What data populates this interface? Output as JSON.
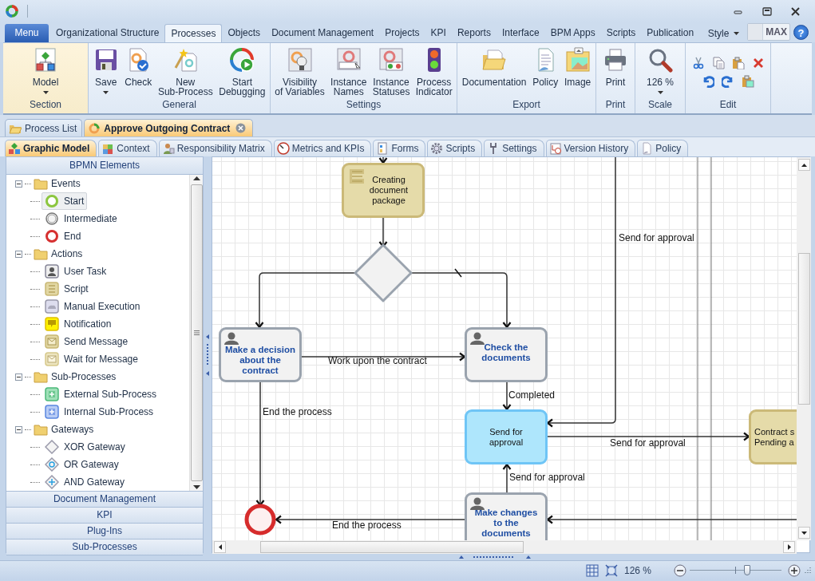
{
  "ribbon_tabs": [
    {
      "label": "Menu",
      "kind": "menu",
      "selected": false
    },
    {
      "label": "Organizational Structure",
      "kind": "tab",
      "selected": false
    },
    {
      "label": "Processes",
      "kind": "tab",
      "selected": true
    },
    {
      "label": "Objects",
      "kind": "tab",
      "selected": false
    },
    {
      "label": "Document Management",
      "kind": "tab",
      "selected": false
    },
    {
      "label": "Projects",
      "kind": "tab",
      "selected": false
    },
    {
      "label": "KPI",
      "kind": "tab",
      "selected": false
    },
    {
      "label": "Reports",
      "kind": "tab",
      "selected": false
    },
    {
      "label": "Interface",
      "kind": "tab",
      "selected": false
    },
    {
      "label": "BPM Apps",
      "kind": "tab",
      "selected": false
    },
    {
      "label": "Scripts",
      "kind": "tab",
      "selected": false
    },
    {
      "label": "Publication",
      "kind": "tab",
      "selected": false
    }
  ],
  "style_menu": {
    "label": "Style"
  },
  "max_toggle": {
    "label": "MAX",
    "on": false
  },
  "help_button": {
    "label": "?"
  },
  "ribbon": {
    "groups": [
      {
        "label": "Section",
        "active": true,
        "buttons": [
          {
            "lines": [
              "Model"
            ],
            "kind": "model",
            "dropdown": true
          }
        ]
      },
      {
        "label": "General",
        "active": false,
        "buttons": [
          {
            "lines": [
              "Save"
            ],
            "kind": "save",
            "dropdown": true
          },
          {
            "lines": [
              "Check"
            ],
            "kind": "check",
            "dropdown": false
          },
          {
            "lines": [
              "New",
              "Sub-Process"
            ],
            "kind": "new_sub",
            "dropdown": false
          },
          {
            "lines": [
              "Start",
              "Debugging"
            ],
            "kind": "debug",
            "dropdown": false
          }
        ]
      },
      {
        "label": "Settings",
        "active": false,
        "buttons": [
          {
            "lines": [
              "Visibility",
              "of Variables"
            ],
            "kind": "visibility",
            "dropdown": false
          },
          {
            "lines": [
              "Instance",
              "Names"
            ],
            "kind": "names",
            "dropdown": false
          },
          {
            "lines": [
              "Instance",
              "Statuses"
            ],
            "kind": "statuses",
            "dropdown": false
          },
          {
            "lines": [
              "Process",
              "Indicator"
            ],
            "kind": "indicator",
            "dropdown": false
          }
        ]
      },
      {
        "label": "Export",
        "active": false,
        "buttons": [
          {
            "lines": [
              "Documentation"
            ],
            "kind": "documentation",
            "dropdown": false
          },
          {
            "lines": [
              "Policy"
            ],
            "kind": "policy",
            "dropdown": false
          },
          {
            "lines": [
              "Image"
            ],
            "kind": "image",
            "dropdown": false
          }
        ]
      },
      {
        "label": "Print",
        "active": false,
        "buttons": [
          {
            "lines": [
              "Print"
            ],
            "kind": "print",
            "dropdown": false
          }
        ]
      },
      {
        "label": "Scale",
        "active": false,
        "buttons": [
          {
            "lines": [
              "126 %"
            ],
            "kind": "zoom",
            "dropdown": true
          }
        ]
      },
      {
        "label": "Edit",
        "active": false,
        "tools": [
          {
            "kind": "cut"
          },
          {
            "kind": "copy"
          },
          {
            "kind": "paste"
          },
          {
            "kind": "delete"
          },
          {
            "kind": "undo"
          },
          {
            "kind": "redo"
          },
          {
            "kind": "paste_special"
          }
        ]
      }
    ]
  },
  "document_tabs": [
    {
      "label": "Process List",
      "kind": "list",
      "selected": false,
      "closable": false
    },
    {
      "label": "Approve Outgoing Contract",
      "kind": "process",
      "selected": true,
      "closable": true
    }
  ],
  "view_tabs": [
    {
      "label": "Graphic Model",
      "kind": "diagram",
      "selected": true
    },
    {
      "label": "Context",
      "kind": "context",
      "selected": false
    },
    {
      "label": "Responsibility Matrix",
      "kind": "responsibility",
      "selected": false
    },
    {
      "label": "Metrics and KPIs",
      "kind": "metrics",
      "selected": false
    },
    {
      "label": "Forms",
      "kind": "forms",
      "selected": false
    },
    {
      "label": "Scripts",
      "kind": "scripts",
      "selected": false
    },
    {
      "label": "Settings",
      "kind": "settings",
      "selected": false
    },
    {
      "label": "Version History",
      "kind": "history",
      "selected": false
    },
    {
      "label": "Policy",
      "kind": "policy",
      "selected": false
    }
  ],
  "sidebar": {
    "title": "BPMN Elements",
    "tree": [
      {
        "label": "Events",
        "expanded": true,
        "children": [
          {
            "label": "Start",
            "kind": "start",
            "selected": true
          },
          {
            "label": "Intermediate",
            "kind": "intermediate",
            "selected": false
          },
          {
            "label": "End",
            "kind": "end",
            "selected": false
          }
        ]
      },
      {
        "label": "Actions",
        "expanded": true,
        "children": [
          {
            "label": "User Task",
            "kind": "user_task",
            "selected": false
          },
          {
            "label": "Script",
            "kind": "script",
            "selected": false
          },
          {
            "label": "Manual Execution",
            "kind": "manual",
            "selected": false
          },
          {
            "label": "Notification",
            "kind": "notification",
            "selected": false
          },
          {
            "label": "Send Message",
            "kind": "send_message",
            "selected": false
          },
          {
            "label": "Wait for Message",
            "kind": "wait_message",
            "selected": false
          }
        ]
      },
      {
        "label": "Sub-Processes",
        "expanded": true,
        "children": [
          {
            "label": "External Sub-Process",
            "kind": "external_sub",
            "selected": false
          },
          {
            "label": "Internal Sub-Process",
            "kind": "internal_sub",
            "selected": false
          }
        ]
      },
      {
        "label": "Gateways",
        "expanded": true,
        "children": [
          {
            "label": "XOR Gateway",
            "kind": "xor",
            "selected": false
          },
          {
            "label": "OR Gateway",
            "kind": "or",
            "selected": false
          },
          {
            "label": "AND Gateway",
            "kind": "and",
            "selected": false
          }
        ]
      }
    ],
    "sections": [
      {
        "label": "Document Management"
      },
      {
        "label": "KPI"
      },
      {
        "label": "Plug-Ins"
      },
      {
        "label": "Sub-Processes"
      }
    ]
  },
  "diagram": {
    "nodes": [
      {
        "kind": "script",
        "lines": [
          "Creating document package"
        ],
        "selected": false
      },
      {
        "kind": "xor_gateway",
        "selected": false
      },
      {
        "kind": "user_task",
        "lines": [
          "Make a decision about the contract"
        ],
        "selected": false
      },
      {
        "kind": "user_task",
        "lines": [
          "Check the documents"
        ],
        "selected": false
      },
      {
        "kind": "task",
        "lines": [
          "Send for approval"
        ],
        "selected": true
      },
      {
        "kind": "status",
        "lines": [
          "Contract s",
          "Pending a"
        ],
        "selected": false
      },
      {
        "kind": "end_event",
        "selected": false
      },
      {
        "kind": "user_task",
        "lines": [
          "Make changes to the documents"
        ],
        "selected": false
      }
    ],
    "edge_labels": [
      "Send for approval",
      "Work upon the contract",
      "Completed",
      "End the process",
      "Send for approval",
      "Send for approval",
      "End the process"
    ]
  },
  "status_bar": {
    "zoom": "126 %",
    "level": 0.63
  }
}
